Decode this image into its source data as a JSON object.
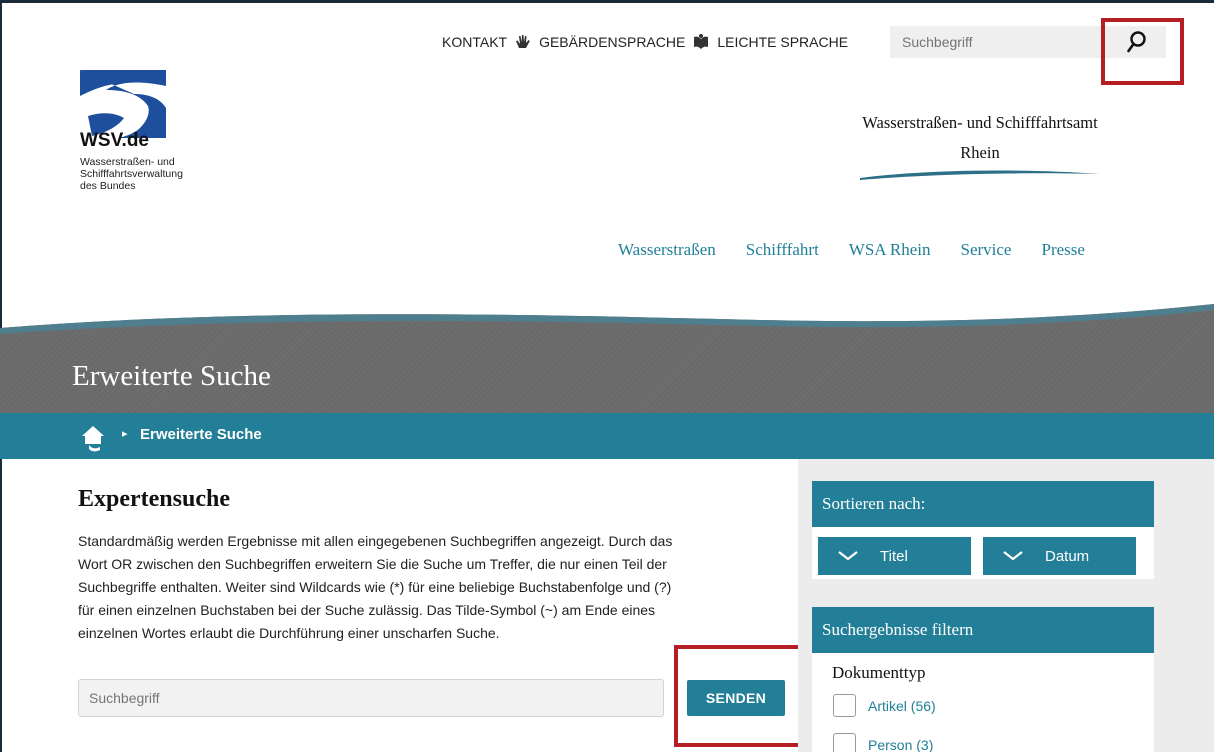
{
  "header": {
    "util_links": [
      {
        "label": "KONTAKT",
        "icon": "hand-icon"
      },
      {
        "label": "GEBÄRDENSPRACHE",
        "icon": "book-icon"
      },
      {
        "label": "LEICHTE SPRACHE"
      }
    ],
    "search": {
      "placeholder": "Suchbegriff",
      "icon": "search-icon"
    },
    "logo": {
      "name": "WSV.de",
      "sub_lines": [
        "Wasserstraßen- und",
        "Schifffahrtsverwaltung",
        "des Bundes"
      ]
    },
    "office_lines": [
      "Wasserstraßen- und Schifffahrtsamt",
      "Rhein"
    ],
    "nav": [
      "Wasserstraßen",
      "Schifffahrt",
      "WSA Rhein",
      "Service",
      "Presse"
    ]
  },
  "hero": {
    "title": "Erweiterte Suche"
  },
  "breadcrumb": {
    "current": "Erweiterte Suche",
    "home_icon": "home-icon"
  },
  "main": {
    "heading": "Expertensuche",
    "description_lines": [
      "Standardmäßig werden Ergebnisse mit allen eingegebenen Suchbegriffen angezeigt. Durch das",
      "Wort OR zwischen den Suchbegriffen erweitern Sie die Suche um Treffer, die nur einen Teil der",
      "Suchbegriffe enthalten. Weiter sind Wildcards wie (*) für eine beliebige Buchstabenfolge und (?)",
      "für einen einzelnen Buchstaben bei der Suche zulässig. Das Tilde-Symbol (~) am Ende eines",
      "einzelnen Wortes erlaubt die Durchführung einer unscharfen Suche."
    ],
    "query": {
      "placeholder": "Suchbegriff"
    },
    "submit_label": "SENDEN"
  },
  "sidebar": {
    "sort": {
      "title": "Sortieren nach:",
      "options": [
        "Titel",
        "Datum"
      ]
    },
    "filter": {
      "title": "Suchergebnisse filtern",
      "group_title": "Dokumenttyp",
      "items": [
        "Artikel (56)",
        "Person (3)"
      ]
    }
  },
  "colors": {
    "accent": "#237f97",
    "highlight": "#b51f24"
  }
}
